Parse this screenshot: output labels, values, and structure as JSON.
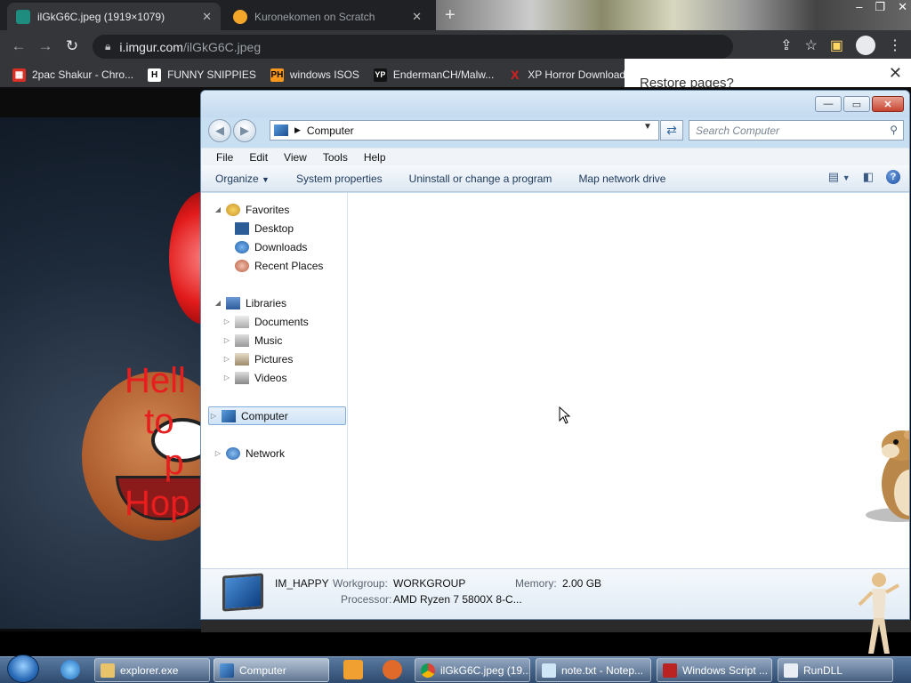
{
  "browser": {
    "tabs": [
      {
        "title": "ilGkG6C.jpeg (1919×1079)",
        "active": true
      },
      {
        "title": "Kuronekomen on Scratch",
        "active": false
      }
    ],
    "new_tab": "+",
    "window_controls": [
      "–",
      "❐",
      "✕"
    ],
    "url_host": "i.imgur.com",
    "url_path": "/ilGkG6C.jpeg",
    "bookmarks": [
      {
        "label": "2pac Shakur - Chro...",
        "icon": "chrome-store-icon"
      },
      {
        "label": "FUNNY SNIPPIES",
        "icon": "H"
      },
      {
        "label": "windows ISOS",
        "icon": "PH"
      },
      {
        "label": "EndermanCH/Malw...",
        "icon": "YP"
      },
      {
        "label": "XP Horror Download",
        "icon": "X"
      }
    ],
    "restore_popup_title": "Restore pages?"
  },
  "page_image": {
    "overlay_lines": "Hell\n  to\n    p\nHop"
  },
  "explorer": {
    "window_controls": [
      "—",
      "▭",
      "✕"
    ],
    "address": "Computer",
    "search_placeholder": "Search Computer",
    "menu": [
      "File",
      "Edit",
      "View",
      "Tools",
      "Help"
    ],
    "commands": [
      "Organize",
      "System properties",
      "Uninstall or change a program",
      "Map network drive"
    ],
    "nav": {
      "favorites_header": "Favorites",
      "favorites": [
        "Desktop",
        "Downloads",
        "Recent Places"
      ],
      "libraries_header": "Libraries",
      "libraries": [
        "Documents",
        "Music",
        "Pictures",
        "Videos"
      ],
      "computer": "Computer",
      "network": "Network"
    },
    "details": {
      "name": "IM_HAPPY",
      "workgroup_label": "Workgroup:",
      "workgroup": "WORKGROUP",
      "memory_label": "Memory:",
      "memory": "2.00 GB",
      "processor_label": "Processor:",
      "processor": "AMD Ryzen 7 5800X 8-C..."
    }
  },
  "taskbar": {
    "buttons": [
      {
        "label": "explorer.exe",
        "active": false
      },
      {
        "label": "Computer",
        "active": true
      },
      {
        "label": "ilGkG6C.jpeg (19...",
        "active": false
      },
      {
        "label": "note.txt - Notep...",
        "active": false
      },
      {
        "label": "Windows Script ...",
        "active": false
      },
      {
        "label": "RunDLL",
        "active": false
      }
    ]
  },
  "colors": {
    "chrome_dark": "#202124",
    "chrome_toolbar": "#35363a",
    "explorer_frame": "#c8dff2",
    "overlay_red": "#e81d1d"
  }
}
